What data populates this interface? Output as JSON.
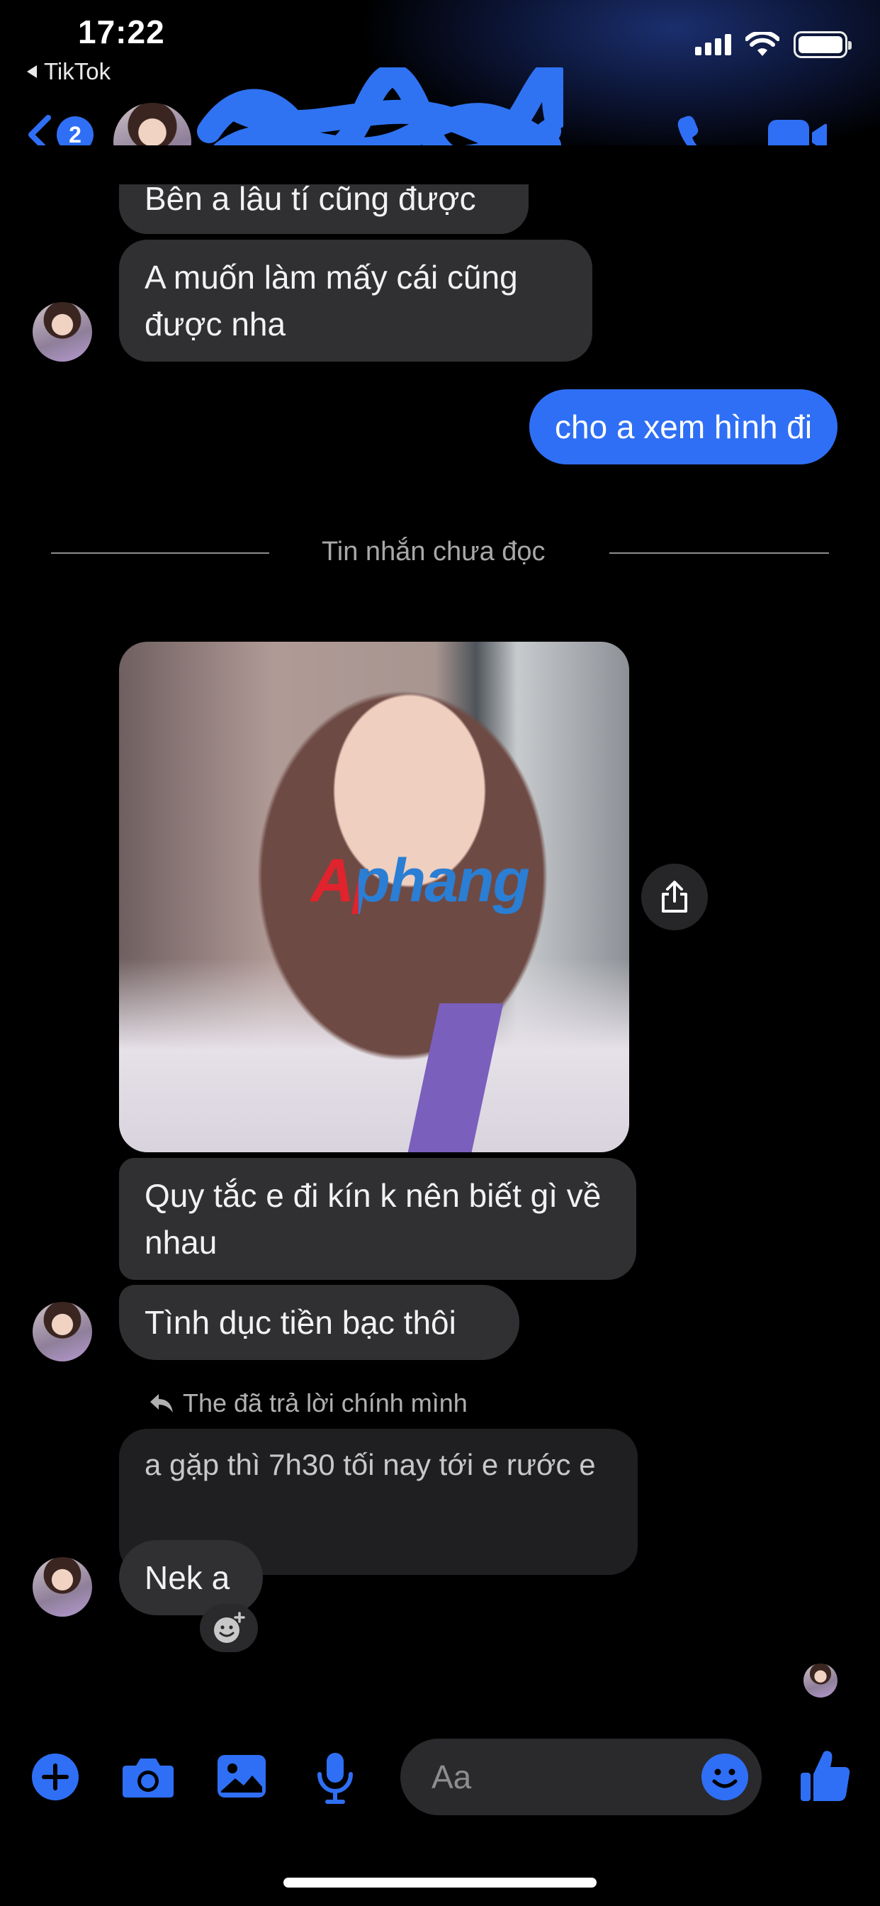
{
  "status_bar": {
    "time": "17:22",
    "back_app": "TikTok"
  },
  "header": {
    "back_count": "2"
  },
  "messages": {
    "m1": "Bên a lâu tí cũng được",
    "m2": "A muốn làm mấy cái cũng được nha",
    "m3": "cho a xem hình đi",
    "unread_divider": "Tin nhắn chưa đọc",
    "photo_watermark": "Aphang",
    "m4": "Quy tắc e đi kín k nên biết gì về nhau",
    "m5": "Tình dục tiền bạc thôi",
    "reply_label": "The đã trả lời chính mình",
    "reply_quote": "a gặp thì 7h30 tối nay tới e rước e",
    "m6": "Nek a"
  },
  "composer": {
    "placeholder": "Aa"
  },
  "colors": {
    "accent": "#2f6ff5",
    "bubble_in": "#303033",
    "background": "#000000"
  },
  "icons": [
    "back-chevron-icon",
    "phone-icon",
    "video-camera-icon",
    "share-icon",
    "reply-arrow-icon",
    "add-reaction-icon",
    "plus-icon",
    "camera-icon",
    "gallery-icon",
    "microphone-icon",
    "emoji-icon",
    "thumbs-up-icon"
  ]
}
